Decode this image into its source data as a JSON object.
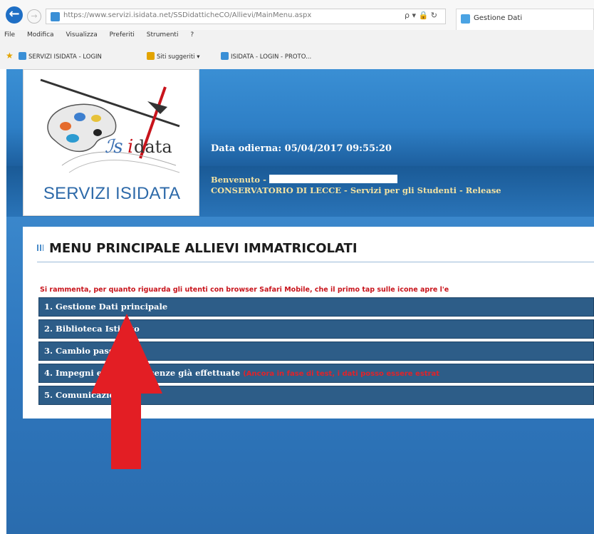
{
  "browser": {
    "url": "https://www.servizi.isidata.net/SSDidatticheCO/Allievi/MainMenu.aspx",
    "url_tools": "ρ ▾ 🔒 ↻",
    "tab_title": "Gestione Dati",
    "menu": [
      "File",
      "Modifica",
      "Visualizza",
      "Preferiti",
      "Strumenti",
      "?"
    ],
    "favorites": [
      {
        "label": "SERVIZI ISIDATA - LOGIN",
        "color": "#3a8fd6"
      },
      {
        "label": "Siti suggeriti ▾",
        "color": "#e3a400"
      },
      {
        "label": "ISIDATA - LOGIN - PROTO...",
        "color": "#3a8fd6"
      }
    ]
  },
  "header": {
    "logo_caption": "SERVIZI ISIDATA",
    "date_line": "Data odierna: 05/04/2017 09:55:20",
    "welcome_label": "Benvenuto -",
    "institution_line": "CONSERVATORIO DI LECCE - Servizi per gli Studenti - Release"
  },
  "panel": {
    "title": "MENU PRINCIPALE ALLIEVI IMMATRICOLATI",
    "notice": "Si rammenta, per quanto riguarda gli utenti con browser Safari Mobile, che il primo tap sulle icone apre l'e",
    "items": [
      {
        "label": "1. Gestione Dati principale",
        "warn": ""
      },
      {
        "label": "2. Biblioteca Istituto",
        "warn": ""
      },
      {
        "label": "3. Cambio password",
        "warn": ""
      },
      {
        "label": "4. Impegni esami e presenze già effettuate",
        "warn": "(Ancora in fase di test, i dati posso essere estrat"
      },
      {
        "label": "5. Comunicazioni",
        "warn": ""
      }
    ]
  },
  "colors": {
    "accent_blue": "#2a73b8",
    "menu_bar": "#2d5d88",
    "notice_red": "#c8141c",
    "arrow_red": "#e31e24"
  },
  "icons": {
    "back": "arrow-left-icon",
    "forward": "arrow-right-icon",
    "favorites_star": "star-icon",
    "annotation": "red-up-arrow"
  }
}
